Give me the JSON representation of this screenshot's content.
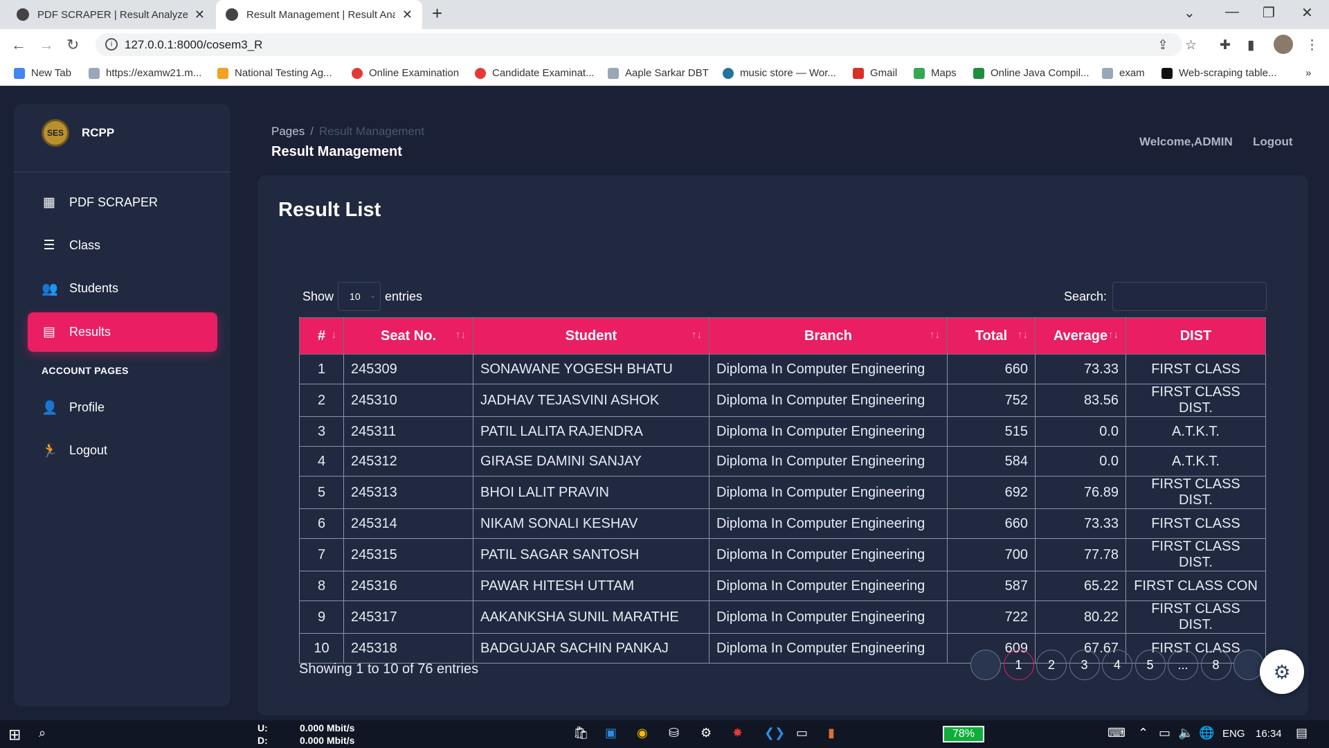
{
  "browser": {
    "tabs": [
      {
        "title": "PDF SCRAPER | Result Analyzer S",
        "active": false
      },
      {
        "title": "Result Management | Result Anal",
        "active": true
      }
    ],
    "url": "127.0.0.1:8000/cosem3_R",
    "bookmarks": [
      {
        "label": "New Tab",
        "color": "#4285f4"
      },
      {
        "label": "https://examw21.m...",
        "color": "#9aa7b8"
      },
      {
        "label": "National Testing Ag...",
        "color": "#f4a020"
      },
      {
        "label": "Online Examination",
        "color": "#e53935"
      },
      {
        "label": "Candidate Examinat...",
        "color": "#e53935"
      },
      {
        "label": "Aaple Sarkar DBT",
        "color": "#9aa7b8"
      },
      {
        "label": "music store — Wor...",
        "color": "#21759b"
      },
      {
        "label": "Gmail",
        "color": "#d93025"
      },
      {
        "label": "Maps",
        "color": "#34a853"
      },
      {
        "label": "Online Java Compil...",
        "color": "#1e8e3e"
      },
      {
        "label": "exam",
        "color": "#9aa7b8"
      },
      {
        "label": "Web-scraping table...",
        "color": "#111111"
      }
    ],
    "more": "»"
  },
  "sidebar": {
    "brand": "RCPP",
    "logo_text": "SES",
    "items": [
      {
        "label": "PDF SCRAPER",
        "icon": "dashboard-icon",
        "glyph": "▦",
        "active": false
      },
      {
        "label": "Class",
        "icon": "list-icon",
        "glyph": "☰",
        "active": false
      },
      {
        "label": "Students",
        "icon": "people-icon",
        "glyph": "👥",
        "active": false
      },
      {
        "label": "Results",
        "icon": "receipt-icon",
        "glyph": "▤",
        "active": true
      }
    ],
    "section_label": "ACCOUNT PAGES",
    "account_items": [
      {
        "label": "Profile",
        "icon": "person-icon",
        "glyph": "👤"
      },
      {
        "label": "Logout",
        "icon": "running-icon",
        "glyph": "🏃"
      }
    ]
  },
  "header": {
    "breadcrumb_root": "Pages",
    "breadcrumb_sep": "/",
    "breadcrumb_current": "Result Management",
    "page_title": "Result Management",
    "welcome": "Welcome,ADMIN",
    "logout": "Logout"
  },
  "card": {
    "title": "Result List",
    "show_label": "Show",
    "entries_value": "10",
    "entries_label": "entries",
    "search_label": "Search:",
    "search_value": ""
  },
  "table": {
    "columns": [
      "#",
      "Seat No.",
      "Student",
      "Branch",
      "Total",
      "Average",
      "DIST"
    ],
    "rows": [
      [
        "1",
        "245309",
        "SONAWANE YOGESH BHATU",
        "Diploma In Computer Engineering",
        "660",
        "73.33",
        "FIRST CLASS"
      ],
      [
        "2",
        "245310",
        "JADHAV TEJASVINI ASHOK",
        "Diploma In Computer Engineering",
        "752",
        "83.56",
        "FIRST CLASS DIST."
      ],
      [
        "3",
        "245311",
        "PATIL LALITA RAJENDRA",
        "Diploma In Computer Engineering",
        "515",
        "0.0",
        "A.T.K.T."
      ],
      [
        "4",
        "245312",
        "GIRASE DAMINI SANJAY",
        "Diploma In Computer Engineering",
        "584",
        "0.0",
        "A.T.K.T."
      ],
      [
        "5",
        "245313",
        "BHOI LALIT PRAVIN",
        "Diploma In Computer Engineering",
        "692",
        "76.89",
        "FIRST CLASS DIST."
      ],
      [
        "6",
        "245314",
        "NIKAM SONALI KESHAV",
        "Diploma In Computer Engineering",
        "660",
        "73.33",
        "FIRST CLASS"
      ],
      [
        "7",
        "245315",
        "PATIL SAGAR SANTOSH",
        "Diploma In Computer Engineering",
        "700",
        "77.78",
        "FIRST CLASS DIST."
      ],
      [
        "8",
        "245316",
        "PAWAR HITESH UTTAM",
        "Diploma In Computer Engineering",
        "587",
        "65.22",
        "FIRST CLASS CON"
      ],
      [
        "9",
        "245317",
        "AAKANKSHA SUNIL MARATHE",
        "Diploma In Computer Engineering",
        "722",
        "80.22",
        "FIRST CLASS DIST."
      ],
      [
        "10",
        "245318",
        "BADGUJAR SACHIN PANKAJ",
        "Diploma In Computer Engineering",
        "609",
        "67.67",
        "FIRST CLASS"
      ]
    ],
    "info": "Showing 1 to 10 of 76 entries"
  },
  "pagination": {
    "pages": [
      "",
      "1",
      "2",
      "3",
      "4",
      "5",
      "...",
      "8",
      ""
    ],
    "current": "1"
  },
  "taskbar": {
    "upload_label": "U:",
    "download_label": "D:",
    "upload_speed": "0.000 Mbit/s",
    "download_speed": "0.000 Mbit/s",
    "battery": "78%",
    "language": "ENG",
    "time": "16:34"
  },
  "colors": {
    "accent": "#e91e63",
    "background": "#1a2035",
    "card": "#202940"
  }
}
